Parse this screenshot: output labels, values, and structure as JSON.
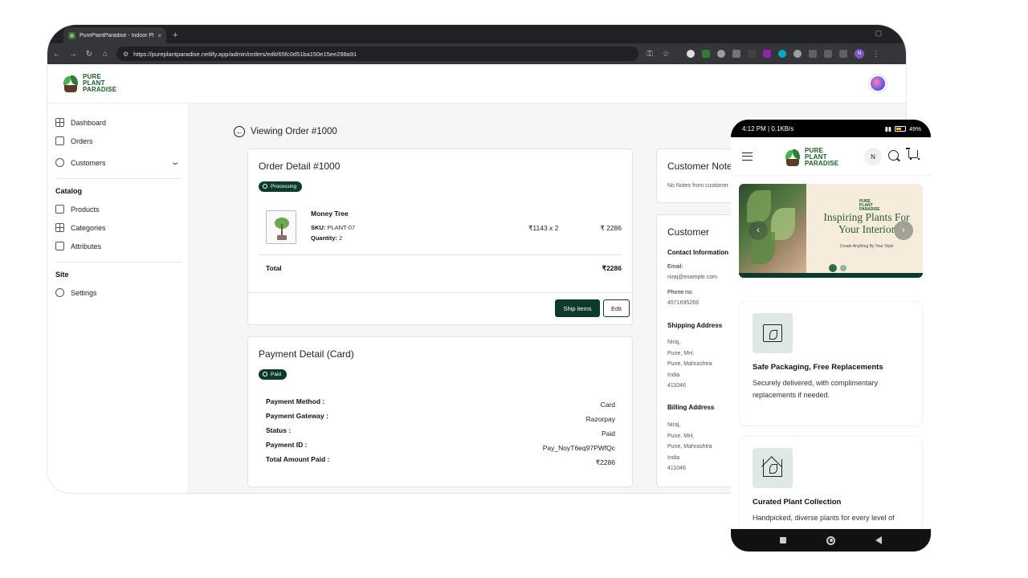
{
  "browser": {
    "tab_title": "PurePlantParadise - Indoor Plan",
    "tab_close": "×",
    "new_tab": "+",
    "url": "https://pureplantparadise.netlify.app/admin/orders/edit/65fc0d51ba150e15ee298a91",
    "profile_initial": "N"
  },
  "brand": {
    "line1": "PURE",
    "line2": "PLANT",
    "line3": "PARADISE"
  },
  "sidebar": {
    "items": [
      {
        "label": "Dashboard"
      },
      {
        "label": "Orders"
      },
      {
        "label": "Customers"
      }
    ],
    "catalog_title": "Catalog",
    "catalog_items": [
      {
        "label": "Products"
      },
      {
        "label": "Categories"
      },
      {
        "label": "Attributes"
      }
    ],
    "site_title": "Site",
    "site_items": [
      {
        "label": "Settings"
      }
    ]
  },
  "order": {
    "back_label": "Viewing Order #1000",
    "detail_title": "Order Detail #1000",
    "status": "Processing",
    "product": {
      "name": "Money Tree",
      "sku_label": "SKU:",
      "sku": "PLANT-07",
      "qty_label": "Quantity:",
      "qty": "2",
      "price_qty": "₹1143 x 2",
      "line_total": "₹ 2286"
    },
    "total_label": "Total",
    "total_value": "₹2286",
    "ship_label": "Ship items",
    "edit_label": "Edit"
  },
  "payment": {
    "title": "Payment Detail (Card)",
    "status": "Paid",
    "rows": [
      {
        "label": "Payment Method :",
        "value": "Card"
      },
      {
        "label": "Payment Gateway :",
        "value": "Razorpay"
      },
      {
        "label": "Status :",
        "value": "Paid"
      },
      {
        "label": "Payment ID :",
        "value": "Pay_NoyT6eq97PWfQc"
      },
      {
        "label": "Total Amount Paid :",
        "value": "₹2286"
      }
    ]
  },
  "notes": {
    "title": "Customer Notes",
    "text": "No Notes from customer"
  },
  "customer": {
    "title": "Customer",
    "contact_title": "Contact Information",
    "email_label": "Email:",
    "email": "niraj@example.com",
    "phone_label": "Phone no:",
    "phone": "4571695269",
    "shipping_title": "Shipping Address",
    "shipping": [
      "Niraj,",
      "Pune, MH,",
      "Pune, Mahrashtra",
      "India",
      "411046"
    ],
    "billing_title": "Billing Address",
    "billing": [
      "Niraj,",
      "Pune, MH,",
      "Pune, Mahrashtra",
      "India",
      "411046"
    ]
  },
  "phone": {
    "status_time": "4:12 PM | 0.1KB/s",
    "battery": "49%",
    "avatar_initial": "N",
    "banner_title": "Inspiring Plants For Your Interior",
    "banner_sub": "Create Anything By Your Style",
    "prev_arrow": "‹",
    "next_arrow": "›",
    "features": [
      {
        "title": "Safe Packaging, Free Replacements",
        "desc": "Securely delivered, with complimentary replacements if needed."
      },
      {
        "title": "Curated Plant Collection",
        "desc": "Handpicked, diverse plants for every level of"
      }
    ]
  },
  "colors": {
    "accent": "#0c3b2e",
    "brand_green": "#1b5e20",
    "page_bg": "#f6f6f6"
  }
}
